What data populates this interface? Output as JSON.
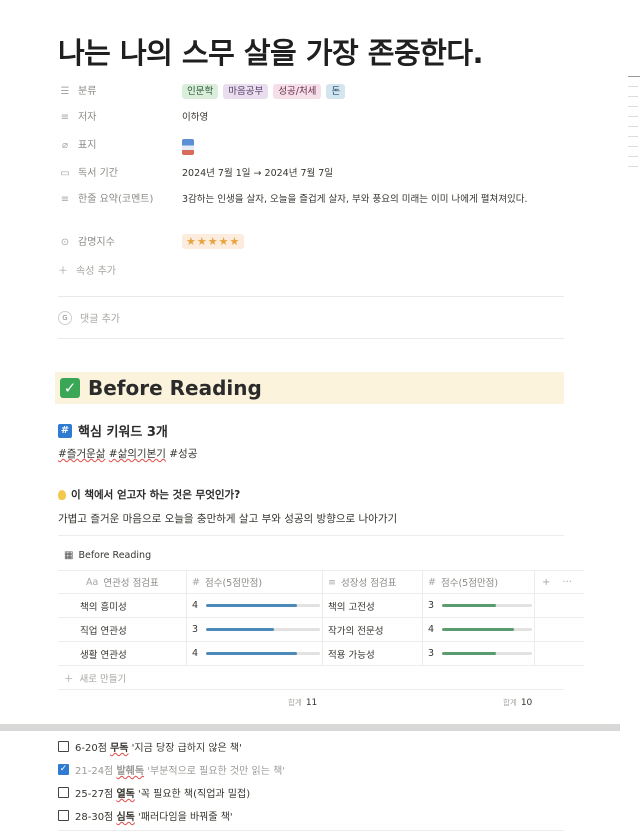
{
  "page": {
    "title": "나는 나의 스무 살을 가장 존중한다."
  },
  "properties": [
    {
      "icon": "list-icon",
      "glyph": "☰",
      "label": "분류",
      "type": "tags",
      "tags": [
        {
          "text": "인문학",
          "bg": "#dbeddb",
          "fg": "#2c5a39"
        },
        {
          "text": "마음공부",
          "bg": "#e8deee",
          "fg": "#5a3b6b"
        },
        {
          "text": "성공/처세",
          "bg": "#f5e0e9",
          "fg": "#6b2f4a"
        },
        {
          "text": "돈",
          "bg": "#d3e5ef",
          "fg": "#1f4a66"
        }
      ]
    },
    {
      "icon": "text-icon",
      "glyph": "≡",
      "label": "저자",
      "type": "text",
      "value": "이하영"
    },
    {
      "icon": "paperclip-icon",
      "glyph": "⌀",
      "label": "표지",
      "type": "file"
    },
    {
      "icon": "calendar-icon",
      "glyph": "▭",
      "label": "독서 기간",
      "type": "text",
      "value": "2024년 7월 1일 → 2024년 7월 7일"
    },
    {
      "icon": "text-icon",
      "glyph": "≡",
      "label": "한줄 요약(코멘트)",
      "type": "multiline",
      "value": "3감하는 인생을 살자, 오늘을 즐겁게 살자, 부와 풍요의 미래는 이미 나에게 펼쳐져있다."
    },
    {
      "icon": "select-icon",
      "glyph": "⊙",
      "label": "감명지수",
      "type": "rating",
      "value": "★★★★★"
    }
  ],
  "add_property": "속성 추가",
  "comment": {
    "avatar": "G",
    "label": "댓글 추가"
  },
  "callout": {
    "title": "Before Reading"
  },
  "keywords": {
    "heading": "핵심 키워드 3개",
    "items": [
      "#즐거운삶",
      "#삶의기본기",
      "#성공"
    ]
  },
  "question": {
    "heading": "이 책에서 얻고자 하는 것은 무엇인가?",
    "answer": "가볍고 즐거운 마음으로 오늘을 충만하게 살고 부와 성공의 방향으로 나아가기"
  },
  "database": {
    "title": "Before Reading",
    "columns": [
      {
        "icon": "Aa",
        "label": "연관성 점검표"
      },
      {
        "icon": "#",
        "label": "점수(5점만점)"
      },
      {
        "icon": "≡",
        "label": "성장성 점검표"
      },
      {
        "icon": "#",
        "label": "점수(5점만점)"
      }
    ],
    "rows": [
      {
        "c1": "책의 흥미성",
        "s1": "4",
        "c2": "책의 고전성",
        "s2": "3"
      },
      {
        "c1": "직업 연관성",
        "s1": "3",
        "c2": "작가의 전문성",
        "s2": "4"
      },
      {
        "c1": "생활 연관성",
        "s1": "4",
        "c2": "적용 가능성",
        "s2": "3"
      }
    ],
    "score_max": 5,
    "new_row": "새로 만들기",
    "sum_label": "합계",
    "sum1": "11",
    "sum2": "10",
    "add_column": "+",
    "more": "···"
  },
  "todos": [
    {
      "checked": false,
      "prefix": "6-20점 ",
      "em": "무독",
      "suffix": " '지금 당장 급하지 않은 책'"
    },
    {
      "checked": true,
      "prefix": "21-24점 ",
      "em": "발췌독",
      "suffix": " '부분적으로 필요한 것만 읽는 책'"
    },
    {
      "checked": false,
      "prefix": "25-27점 ",
      "em": "열독",
      "suffix": " '꼭 필요한 책(직업과 밀접)"
    },
    {
      "checked": false,
      "prefix": "28-30점 ",
      "em": "심독",
      "suffix": " '패러다임을 바꿔줄 책'"
    }
  ]
}
